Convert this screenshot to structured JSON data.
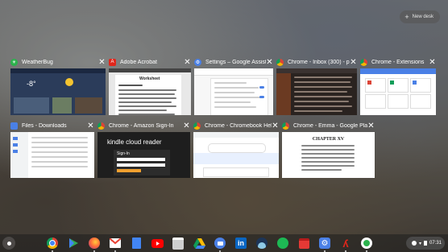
{
  "desk": {
    "new_desk_label": "New desk"
  },
  "windows": [
    {
      "title": "WeatherBug",
      "icon": "weatherbug-icon",
      "color": "#27ae60",
      "temp": "-8°"
    },
    {
      "title": "Adobe Acrobat",
      "icon": "adobe-acrobat-icon",
      "color": "#e0261b",
      "doc_heading": "Worksheet"
    },
    {
      "title": "Settings – Google Assist…",
      "icon": "settings-icon",
      "color": "#4a80e6"
    },
    {
      "title": "Chrome - Inbox (300) - p…",
      "icon": "chrome-icon",
      "color": "#e8ac2a"
    },
    {
      "title": "Chrome - Extensions",
      "icon": "chrome-icon",
      "color": "#e8ac2a"
    },
    {
      "title": "Files - Downloads",
      "icon": "files-icon",
      "color": "#4a80e6"
    },
    {
      "title": "Chrome - Amazon Sign-In",
      "icon": "chrome-icon",
      "color": "#e8ac2a",
      "kindle_label": "kindle cloud reader",
      "sign_in_label": "Sign-In"
    },
    {
      "title": "Chrome - Chromebook Help",
      "icon": "chrome-icon",
      "color": "#e8ac2a"
    },
    {
      "title": "Chrome - Emma - Google Play",
      "icon": "chrome-icon",
      "color": "#e8ac2a",
      "chapter_label": "CHAPTER XV"
    }
  ],
  "shelf": {
    "apps": [
      "chrome-icon",
      "play-store-icon",
      "firefox-icon",
      "gmail-icon",
      "docs-icon",
      "youtube-icon",
      "printer-icon",
      "drive-icon",
      "files-icon",
      "linkedin-icon",
      "sky-icon",
      "spotify-icon",
      "calendar-icon",
      "settings-icon",
      "adobe-acrobat-icon",
      "weatherbug-icon"
    ],
    "time": "07:31"
  }
}
